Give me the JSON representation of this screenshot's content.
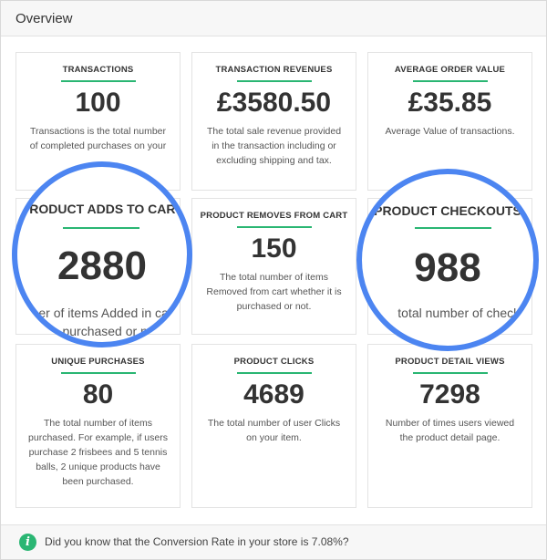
{
  "panel": {
    "title": "Overview"
  },
  "cards": [
    {
      "label": "TRANSACTIONS",
      "value": "100",
      "desc": [
        "Transactions is the total number",
        "of completed purchases on your"
      ]
    },
    {
      "label": "TRANSACTION REVENUES",
      "value": "£3580.50",
      "desc": [
        "The total sale revenue provided",
        "in the transaction including or",
        "excluding shipping and tax."
      ]
    },
    {
      "label": "AVERAGE ORDER VALUE",
      "value": "£35.85",
      "desc": [
        "Average Value of transactions."
      ]
    },
    {
      "label": "PRODUCT ADDS TO CART",
      "value": "2880",
      "desc": [
        "ber of items Added in cart",
        "purchased or not"
      ]
    },
    {
      "label": "PRODUCT REMOVES FROM CART",
      "value": "150",
      "desc": [
        "The total number of items",
        "Removed from cart whether it is",
        "purchased or not."
      ]
    },
    {
      "label": "PRODUCT CHECKOUTS",
      "value": "988",
      "desc": [
        "total number of checkou"
      ]
    },
    {
      "label": "UNIQUE PURCHASES",
      "value": "80",
      "desc": [
        "The total number of items",
        "purchased. For example, if users",
        "purchase 2 frisbees and 5 tennis",
        "balls, 2 unique products have",
        "been purchased."
      ]
    },
    {
      "label": "PRODUCT CLICKS",
      "value": "4689",
      "desc": [
        "The total number of user Clicks",
        "on your item."
      ]
    },
    {
      "label": "PRODUCT DETAIL VIEWS",
      "value": "7298",
      "desc": [
        "Number of times users viewed",
        "the product detail page."
      ]
    }
  ],
  "footer": {
    "icon": "info-icon",
    "text": "Did you know that the Conversion Rate in your store is 7.08%?"
  },
  "colors": {
    "accent": "#2ab673",
    "highlight_ring": "#4c85f1"
  }
}
